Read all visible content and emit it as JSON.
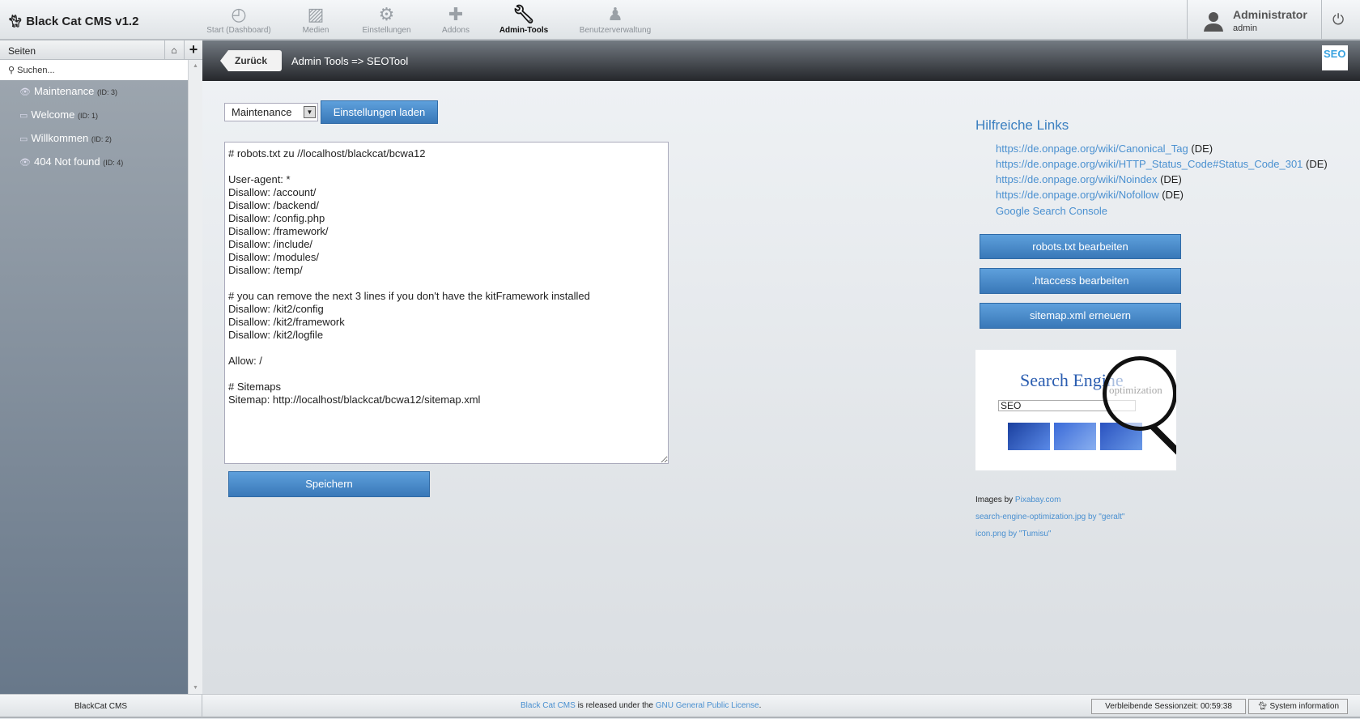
{
  "app": {
    "title": "Black Cat CMS v1.2"
  },
  "nav": [
    {
      "label": "Start (Dashboard)",
      "icon": "dashboard-icon"
    },
    {
      "label": "Medien",
      "icon": "image-icon"
    },
    {
      "label": "Einstellungen",
      "icon": "gears-icon"
    },
    {
      "label": "Addons",
      "icon": "puzzle-icon"
    },
    {
      "label": "Admin-Tools",
      "icon": "wrench-icon",
      "active": true
    },
    {
      "label": "Benutzerverwaltung",
      "icon": "user-manage-icon"
    }
  ],
  "user": {
    "name": "Administrator",
    "login": "admin"
  },
  "sidebar": {
    "title": "Seiten",
    "search_placeholder": "Suchen...",
    "pages": [
      {
        "title": "Maintenance",
        "id": "(ID: 3)",
        "icon": "eye-icon"
      },
      {
        "title": "Welcome",
        "id": "(ID: 1)",
        "icon": "monitor-icon"
      },
      {
        "title": "Willkommen",
        "id": "(ID: 2)",
        "icon": "monitor-icon"
      },
      {
        "title": "404 Not found",
        "id": "(ID: 4)",
        "icon": "eye-icon"
      }
    ]
  },
  "toolbar": {
    "back_label": "Zurück",
    "breadcrumb": "Admin Tools => SEOTool",
    "seo_logo": "SEO"
  },
  "form": {
    "selected_page": "Maintenance",
    "load_label": "Einstellungen laden",
    "save_label": "Speichern",
    "robots_txt": "# robots.txt zu //localhost/blackcat/bcwa12\n\nUser-agent: *\nDisallow: /account/\nDisallow: /backend/\nDisallow: /config.php\nDisallow: /framework/\nDisallow: /include/\nDisallow: /modules/\nDisallow: /temp/\n\n# you can remove the next 3 lines if you don't have the kitFramework installed\nDisallow: /kit2/config\nDisallow: /kit2/framework\nDisallow: /kit2/logfile\n\nAllow: /\n\n# Sitemaps\nSitemap: http://localhost/blackcat/bcwa12/sitemap.xml"
  },
  "help": {
    "title": "Hilfreiche Links",
    "links": [
      {
        "url": "https://de.onpage.org/wiki/Canonical_Tag",
        "lang": "(DE)"
      },
      {
        "url": "https://de.onpage.org/wiki/HTTP_Status_Code#Status_Code_301",
        "lang": "(DE)"
      },
      {
        "url": "https://de.onpage.org/wiki/Noindex",
        "lang": "(DE)"
      },
      {
        "url": "https://de.onpage.org/wiki/Nofollow",
        "lang": "(DE)"
      },
      {
        "url": "Google Search Console",
        "lang": ""
      }
    ],
    "buttons": [
      "robots.txt bearbeiten",
      ".htaccess bearbeiten",
      "sitemap.xml erneuern"
    ],
    "image_text": {
      "title": "Search Engine",
      "sub": "optimization",
      "box": "SEO"
    },
    "credits": {
      "prefix": "Images by",
      "pixabay": "Pixabay.com",
      "img1": "search-engine-optimization.jpg by \"geralt\"",
      "img2": "icon.png by \"Tumisu\""
    }
  },
  "footer": {
    "left": "BlackCat CMS",
    "link1": "Black Cat CMS",
    "mid": " is released under the ",
    "link2": "GNU General Public License",
    "end": ".",
    "session": "Verbleibende Sessionzeit: 00:59:38",
    "sysinfo": "System information"
  },
  "colors": {
    "accent": "#3a7fc0",
    "link": "#4a90d0",
    "button": "#4a8cca"
  }
}
